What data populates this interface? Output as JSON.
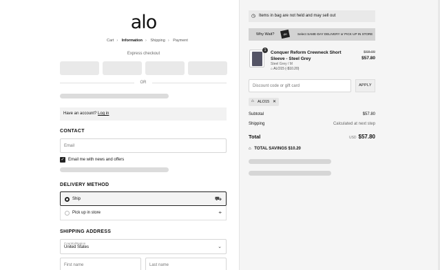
{
  "brand": {
    "logo": "alo"
  },
  "breadcrumbs": [
    "Cart",
    "Information",
    "Shipping",
    "Payment"
  ],
  "breadcrumb_current": "Information",
  "express": {
    "title": "Express checkout",
    "or_label": "OR"
  },
  "account": {
    "prompt": "Have an account?",
    "link": "Log in"
  },
  "contact": {
    "heading": "CONTACT",
    "email_placeholder": "Email",
    "newsletter_label": "Email me with news and offers",
    "newsletter_checked": true
  },
  "delivery": {
    "heading": "DELIVERY METHOD",
    "options": [
      {
        "label": "Ship",
        "selected": true,
        "icon": "truck-icon"
      },
      {
        "label": "Pick up in store",
        "selected": false,
        "icon": "location-pin-icon"
      }
    ]
  },
  "shipping": {
    "heading": "SHIPPING ADDRESS",
    "country_label": "Country/Region",
    "country_value": "United States",
    "first_name_placeholder": "First name",
    "last_name_placeholder": "Last name"
  },
  "summary": {
    "notice": "Items in bag are not held and may sell out",
    "banner": {
      "why_wait": "Why Wait?",
      "select": "Select",
      "same_day": "SAME-DAY DELIVERY",
      "or": "or",
      "pickup": "PICK UP IN STORE"
    },
    "item": {
      "quantity": "1",
      "name": "Conquer Reform Crewneck Short Sleeve - Steel Grey",
      "variant": "Steel Grey / M",
      "discount": "ALO15 (-$10.20)",
      "original_price": "$68.00",
      "price": "$57.80"
    },
    "discount_placeholder": "Discount code or gift card",
    "apply_label": "APPLY",
    "applied_code": "ALO15",
    "subtotal_label": "Subtotal",
    "subtotal_value": "$57.80",
    "shipping_label": "Shipping",
    "shipping_value": "Calculated at next step",
    "total_label": "Total",
    "currency": "USD",
    "total_value": "$57.80",
    "savings_label": "TOTAL SAVINGS",
    "savings_value": "$10.20"
  },
  "colors": {
    "accent": "#111111",
    "panel": "#f5f5f5",
    "skeleton": "#dcdcdc"
  }
}
